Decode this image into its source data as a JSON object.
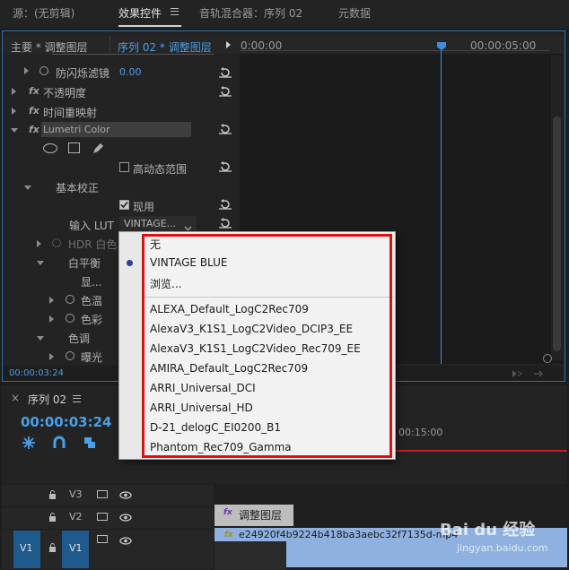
{
  "tabs": [
    {
      "label": "源：(无剪辑)"
    },
    {
      "label": "效果控件"
    },
    {
      "label": "音轨混合器：序列 02"
    },
    {
      "label": "元数据"
    }
  ],
  "effect_controls": {
    "master_label": "主要 * 调整图层",
    "sequence_label": "序列 02 * 调整图层",
    "ruler_start": "0:00:00",
    "ruler_end": "00:00:05:00",
    "timecode": "00:00:03:24",
    "rows": {
      "anti_flicker": "防闪烁滤镜",
      "anti_flicker_value": "0.00",
      "opacity": "不透明度",
      "time_remap": "时间重映射",
      "lumetri": "Lumetri Color",
      "hdr": "高动态范围",
      "basic_correction": "基本校正",
      "apply": "现用",
      "input_lut_label": "输入 LUT",
      "input_lut_value": "VINTAGE...",
      "hdr_white": "HDR 白色",
      "white_balance": "白平衡",
      "display": "显...",
      "temperature": "色温",
      "tint": "色彩",
      "tone": "色调",
      "exposure": "曝光"
    }
  },
  "timeline": {
    "title": "序列 02",
    "timecode": "00:00:03:24",
    "ruler_mark": "00:15:00",
    "tracks": [
      {
        "name": "V3"
      },
      {
        "name": "V2"
      },
      {
        "name": "V1",
        "source": "V1"
      }
    ],
    "clip_adjustment": "调整图层",
    "clip_video": "e24920f4b9224b418ba3aebc32f7135d-mp4"
  },
  "dropdown": {
    "items_top": [
      "无",
      "VINTAGE BLUE",
      "浏览..."
    ],
    "items_luts": [
      "ALEXA_Default_LogC2Rec709",
      "AlexaV3_K1S1_LogC2Video_DCIP3_EE",
      "AlexaV3_K1S1_LogC2Video_Rec709_EE",
      "AMIRA_Default_LogC2Rec709",
      "ARRI_Universal_DCI",
      "ARRI_Universal_HD",
      "D-21_delogC_EI0200_B1",
      "Phantom_Rec709_Gamma"
    ],
    "selected": "VINTAGE BLUE"
  },
  "watermark": {
    "brand": "Bai du 经验",
    "url": "jingyan.baidu.com"
  },
  "colors": {
    "accent": "#4a9fe8",
    "highlight_box": "#e01010",
    "panel_border": "#2f6db0"
  }
}
